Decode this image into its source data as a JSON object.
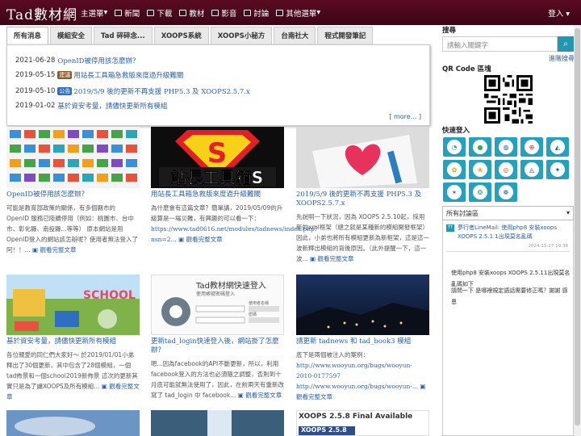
{
  "site": {
    "logo": "Tad數材網"
  },
  "nav": {
    "items": [
      {
        "label": "主選單",
        "icon": "menu-icon",
        "caret": true
      },
      {
        "label": "新聞",
        "icon": "news-icon"
      },
      {
        "label": "下載",
        "icon": "download-icon"
      },
      {
        "label": "教材",
        "icon": "book-icon"
      },
      {
        "label": "影音",
        "icon": "video-icon"
      },
      {
        "label": "討論",
        "icon": "forum-icon"
      },
      {
        "label": "其他選單",
        "icon": "menu-icon",
        "caret": true
      }
    ],
    "login": "登入 ▾"
  },
  "tabs": [
    "所有消息",
    "模組安全",
    "Tad 碎碎念...",
    "XOOPS系統",
    "XOOPS小秘方",
    "台南社大",
    "程式開發筆記"
  ],
  "news": [
    {
      "date": "2021-06-28",
      "badge": "",
      "title": "OpenID被停用該怎麼辦？"
    },
    {
      "date": "2019-05-15",
      "badge": "建議",
      "badge_color": "#8a5a2b",
      "title": "用站長工具箱急救版來度過升級難關"
    },
    {
      "date": "2019-05-10",
      "badge": "公告",
      "badge_color": "#2f6fc0",
      "title": "2019/5/9 後的更新不再支援 PHP5.3 及 XOOPS2.5.7.x"
    },
    {
      "date": "2019-01-02",
      "badge": "",
      "title": "基於資安考量，請儘快更新所有模組"
    }
  ],
  "more": "[ more... ]",
  "readmore": "觀看完整文章",
  "cards": [
    {
      "title": "OpenID被停用該怎麼辦？",
      "desc": "可能是教育部政策的關係，有多個縣市的 OpenID 服務已陸續停用（例如：桃園市、台中市、彰化縣、南投縣...等等） 原本網站是用OpenID登入的網站該怎辦呢？使用者無法登入了阿！！...",
      "link": ""
    },
    {
      "title": "用站長工具箱急救版來度過升級難關",
      "desc": "為什麼會有這篇文章？簡單講，2019/05/09的升級算是一場災難，有興趣的可以看一下：",
      "link": "https://www.tad0616.net/modules/tadnews/index.php?nsn=2..."
    },
    {
      "title": "2019/5/9 後的更新不再支援 PHP5.3 及 XOOPS2.5.7.x",
      "desc": "先說明一下狀況，因為 XOOPS 2.5.10起，採用新的xml框架（總之就是某種新的模組開發框架） 因此，小弟也將所有模組更新為新框架，這是這一波新釋出模組的背後原因。（此外提醒一下，這一波...",
      "link": ""
    },
    {
      "title": "基於資安考量，請儘快更新所有模組",
      "desc": "各位親愛的同仁們大家好～ 於2019/01/01小弟釋出了30個更新，其中包含了28個模組，一個tad佈景和一個school2019新佈景 這次的更新其實只是為了讓XOOPS及所有模組...",
      "link": ""
    },
    {
      "title": "更新tad_login快速登入後，網站掛了怎麼辦？",
      "desc": "嗯...因為facebook的API不斷更新，所以，利用facebook登入的方法也必須隨之調整，否則到十月底可能就無法使用了，因此，在前兩天有重新改寫了 tad_login 中 facebook...",
      "link": ""
    },
    {
      "title": "請更新 tadnews 和 tad_book3 模組",
      "desc": "底下是兩個被注入的案例：",
      "links": [
        "http://www.wooyun.org/bugs/wooyun-2010-0177597",
        "http://www.wooyun.org/bugs/wooyun-..."
      ]
    }
  ],
  "login_card_text": {
    "title": "Tad教材網快速登入",
    "sub": "使用帳號密碼登入",
    "label1": "使用者名稱",
    "label2": "密碼"
  },
  "bottom_card": {
    "title": "XOOPS 2.5.8 Final Available",
    "sub": "XOOPS 2.5.8"
  },
  "sidebar": {
    "search_title": "搜尋",
    "search_placeholder": "請輸入關鍵字",
    "advanced_search": "進階搜尋",
    "qr_title": "QR Code 區塊",
    "quick_login_title": "快速登入",
    "forum_select": "所有討論區",
    "feed": {
      "post1_badge": "TT",
      "post1_text": "夢行者LineMail: 使用php8 安裝xoops XOOPS 2.5.1 1出現莫名亂碼",
      "post1_date": "2024-11-27 19:38",
      "body_line1": "使用php8 安裝xoops XOOPS 2.5.11出現莫名亂碼如下",
      "body_line2": "請問一下 是哪裡規定語話需要修正嗎？謝謝 感恩"
    }
  },
  "colors": {
    "topbar": "#4a0819",
    "accent": "#2397b0",
    "link": "#2a5fa8"
  }
}
